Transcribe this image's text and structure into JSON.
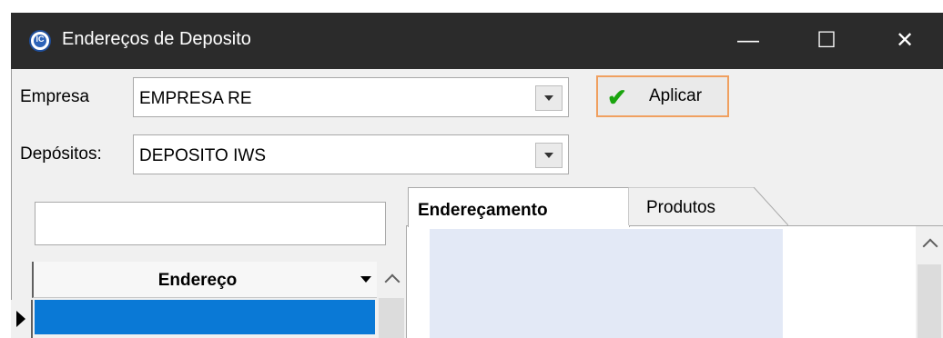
{
  "window": {
    "title": "Endereços de Deposito",
    "icon_text": "IC",
    "minimize_glyph": "—",
    "maximize_glyph": "☐",
    "close_glyph": "✕"
  },
  "form": {
    "empresa_label": "Empresa",
    "empresa_value": "EMPRESA RE",
    "depositos_label": "Depósitos:",
    "depositos_value": "DEPOSITO IWS",
    "apply_label": "Aplicar"
  },
  "grid": {
    "filter_value": "",
    "column_header": "Endereço",
    "selected_row": ""
  },
  "tabs": [
    {
      "label": "Endereçamento",
      "active": true
    },
    {
      "label": "Produtos",
      "active": false
    }
  ],
  "colors": {
    "titlebar": "#2b2b2b",
    "selection": "#0a79d6",
    "apply_border": "#f0a060",
    "check": "#1aa40e"
  }
}
